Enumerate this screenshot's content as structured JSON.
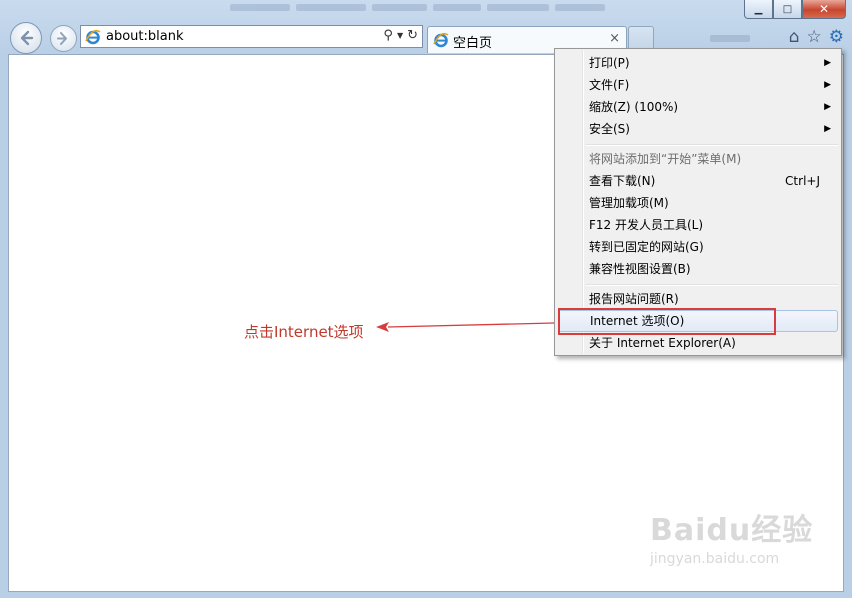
{
  "window": {
    "controls": {
      "minimize": "▭",
      "maximize": "□",
      "close": "x"
    }
  },
  "address_bar": {
    "url": "about:blank"
  },
  "tab": {
    "title": "空白页",
    "close": "×"
  },
  "command_bar": {
    "icons": [
      "home-icon",
      "favorites-star-icon",
      "tools-gear-icon"
    ]
  },
  "tools_menu": {
    "items": [
      {
        "label": "打印(P)",
        "submenu": true
      },
      {
        "label": "文件(F)",
        "submenu": true
      },
      {
        "label": "缩放(Z) (100%)",
        "submenu": true
      },
      {
        "label": "安全(S)",
        "submenu": true
      },
      {
        "label": "将网站添加到“开始”菜单(M)",
        "disabled": true
      },
      {
        "label": "查看下载(N)",
        "shortcut": "Ctrl+J"
      },
      {
        "label": "管理加载项(M)"
      },
      {
        "label": "F12 开发人员工具(L)"
      },
      {
        "label": "转到已固定的网站(G)"
      },
      {
        "label": "兼容性视图设置(B)"
      },
      {
        "label": "报告网站问题(R)"
      },
      {
        "label": "Internet 选项(O)",
        "highlighted": true
      },
      {
        "label": "关于 Internet Explorer(A)"
      }
    ]
  },
  "annotation": {
    "text": "点击Internet选项",
    "color": "#d83d3d"
  },
  "watermark": {
    "logo": "Baidu经验",
    "url": "jingyan.baidu.com"
  }
}
